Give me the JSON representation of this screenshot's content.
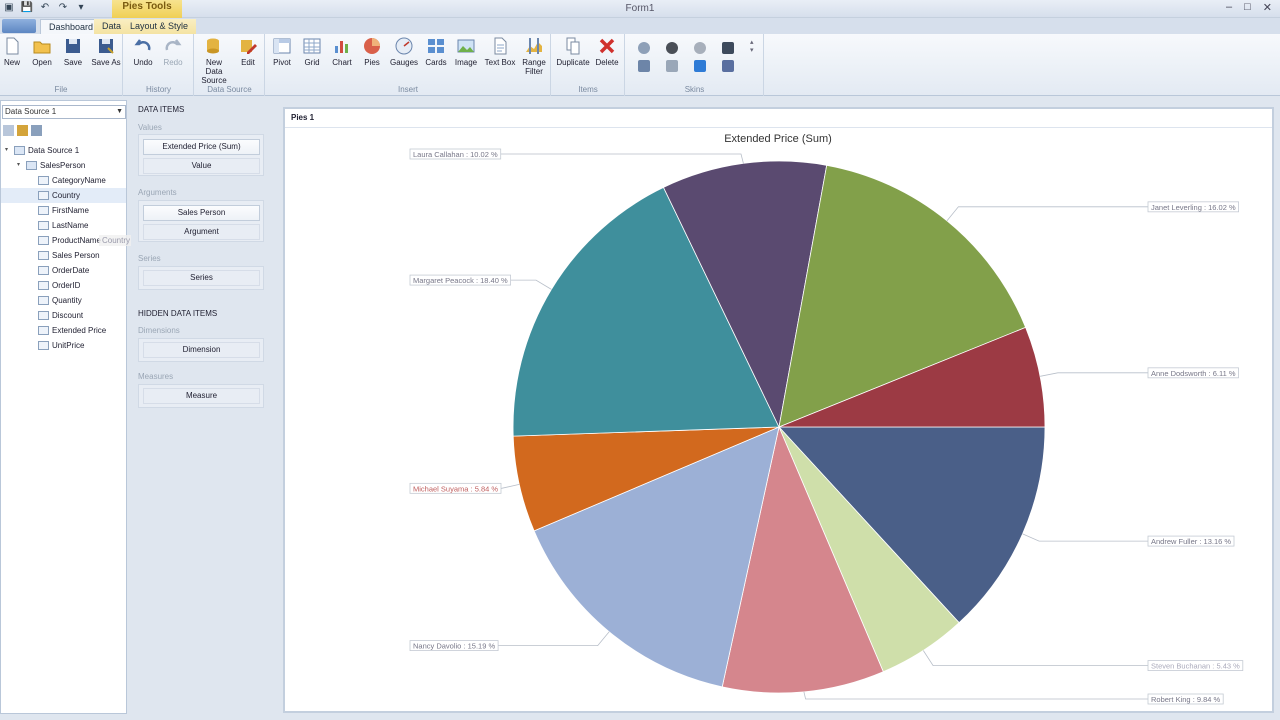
{
  "app": {
    "window_title": "Form1",
    "context_tab_title": "Pies Tools",
    "window_controls": [
      "–",
      "□",
      "✕"
    ]
  },
  "ribbon": {
    "tabs": [
      "Dashboard",
      "Data",
      "Layout & Style"
    ],
    "groups": {
      "file": {
        "label": "File",
        "buttons": [
          "New",
          "Open",
          "Save",
          "Save As"
        ]
      },
      "history": {
        "label": "History",
        "buttons": [
          "Undo",
          "Redo"
        ]
      },
      "data_source": {
        "label": "Data Source",
        "buttons": [
          "New Data Source",
          "Edit"
        ]
      },
      "insert": {
        "label": "Insert",
        "buttons": [
          "Pivot",
          "Grid",
          "Chart",
          "Pies",
          "Gauges",
          "Cards",
          "Image",
          "Text Box",
          "Range Filter"
        ]
      },
      "items": {
        "label": "Items",
        "buttons": [
          "Duplicate",
          "Delete"
        ]
      },
      "skins": {
        "label": "Skins"
      }
    }
  },
  "data_source_panel": {
    "selected": "Data Source 1",
    "tree": [
      {
        "label": "Data Source 1",
        "level": 0,
        "kind": "source"
      },
      {
        "label": "SalesPerson",
        "level": 1,
        "kind": "table"
      },
      {
        "label": "CategoryName",
        "level": 2,
        "kind": "text"
      },
      {
        "label": "Country",
        "level": 2,
        "kind": "text",
        "selected": true
      },
      {
        "label": "FirstName",
        "level": 2,
        "kind": "text"
      },
      {
        "label": "LastName",
        "level": 2,
        "kind": "text"
      },
      {
        "label": "ProductName",
        "level": 2,
        "kind": "text"
      },
      {
        "label": "Sales Person",
        "level": 2,
        "kind": "text"
      },
      {
        "label": "OrderDate",
        "level": 2,
        "kind": "date"
      },
      {
        "label": "OrderID",
        "level": 2,
        "kind": "number"
      },
      {
        "label": "Quantity",
        "level": 2,
        "kind": "number"
      },
      {
        "label": "Discount",
        "level": 2,
        "kind": "number"
      },
      {
        "label": "Extended Price",
        "level": 2,
        "kind": "number"
      },
      {
        "label": "UnitPrice",
        "level": 2,
        "kind": "number"
      }
    ],
    "drag_ghost": "Country"
  },
  "data_items_panel": {
    "title": "DATA ITEMS",
    "values_label": "Values",
    "values_item": "Extended Price (Sum)",
    "values_placeholder": "Value",
    "arguments_label": "Arguments",
    "arguments_item": "Sales Person",
    "arguments_placeholder": "Argument",
    "series_label": "Series",
    "series_placeholder": "Series",
    "hidden_title": "HIDDEN DATA ITEMS",
    "dimensions_label": "Dimensions",
    "dimensions_placeholder": "Dimension",
    "measures_label": "Measures",
    "measures_placeholder": "Measure"
  },
  "dashboard_item": {
    "caption": "Pies 1"
  },
  "chart_data": {
    "type": "pie",
    "title": "Extended Price (Sum)",
    "slices": [
      {
        "label": "Andrew Fuller : 13.16 %",
        "value": 13.16,
        "color": "#4a5f88"
      },
      {
        "label": "Steven Buchanan : 5.43 %",
        "value": 5.43,
        "color": "#cfdfaa"
      },
      {
        "label": "Robert King : 9.84 %",
        "value": 9.84,
        "color": "#d5868d"
      },
      {
        "label": "Nancy Davolio : 15.19 %",
        "value": 15.19,
        "color": "#9cb0d6"
      },
      {
        "label": "Michael Suyama : 5.84 %",
        "value": 5.84,
        "color": "#d2691e"
      },
      {
        "label": "Margaret Peacock : 18.40 %",
        "value": 18.4,
        "color": "#3f8f9c"
      },
      {
        "label": "Laura Callahan : 10.02 %",
        "value": 10.02,
        "color": "#5a4a70"
      },
      {
        "label": "Janet Leverling : 16.02 %",
        "value": 16.02,
        "color": "#82a04a"
      },
      {
        "label": "Anne Dodsworth : 6.11 %",
        "value": 6.11,
        "color": "#9c3a44"
      }
    ]
  }
}
